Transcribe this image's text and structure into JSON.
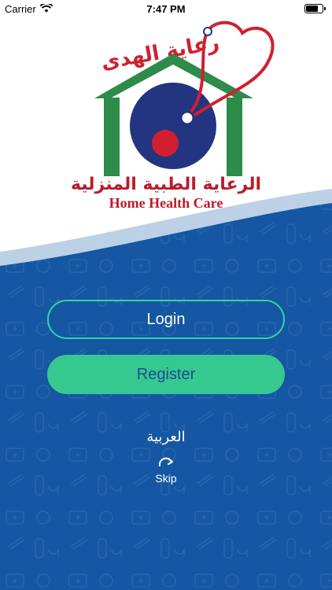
{
  "status_bar": {
    "carrier": "Carrier",
    "time": "7:47 PM"
  },
  "logo": {
    "script_text": "رعاية الهدى",
    "arabic_text": "الرعاية الطبية المنزلية",
    "english_text": "Home Health Care"
  },
  "buttons": {
    "login_label": "Login",
    "register_label": "Register"
  },
  "language_link": "العربية",
  "skip": {
    "label": "Skip"
  },
  "colors": {
    "background_blue": "#1557a3",
    "accent_green": "#36c98f",
    "logo_green": "#2e8b4a",
    "logo_red": "#d0202f",
    "logo_navy": "#233580"
  },
  "icons": [
    "wifi-icon",
    "battery-icon",
    "skip-arrow-icon",
    "medical-doodle-pattern"
  ]
}
